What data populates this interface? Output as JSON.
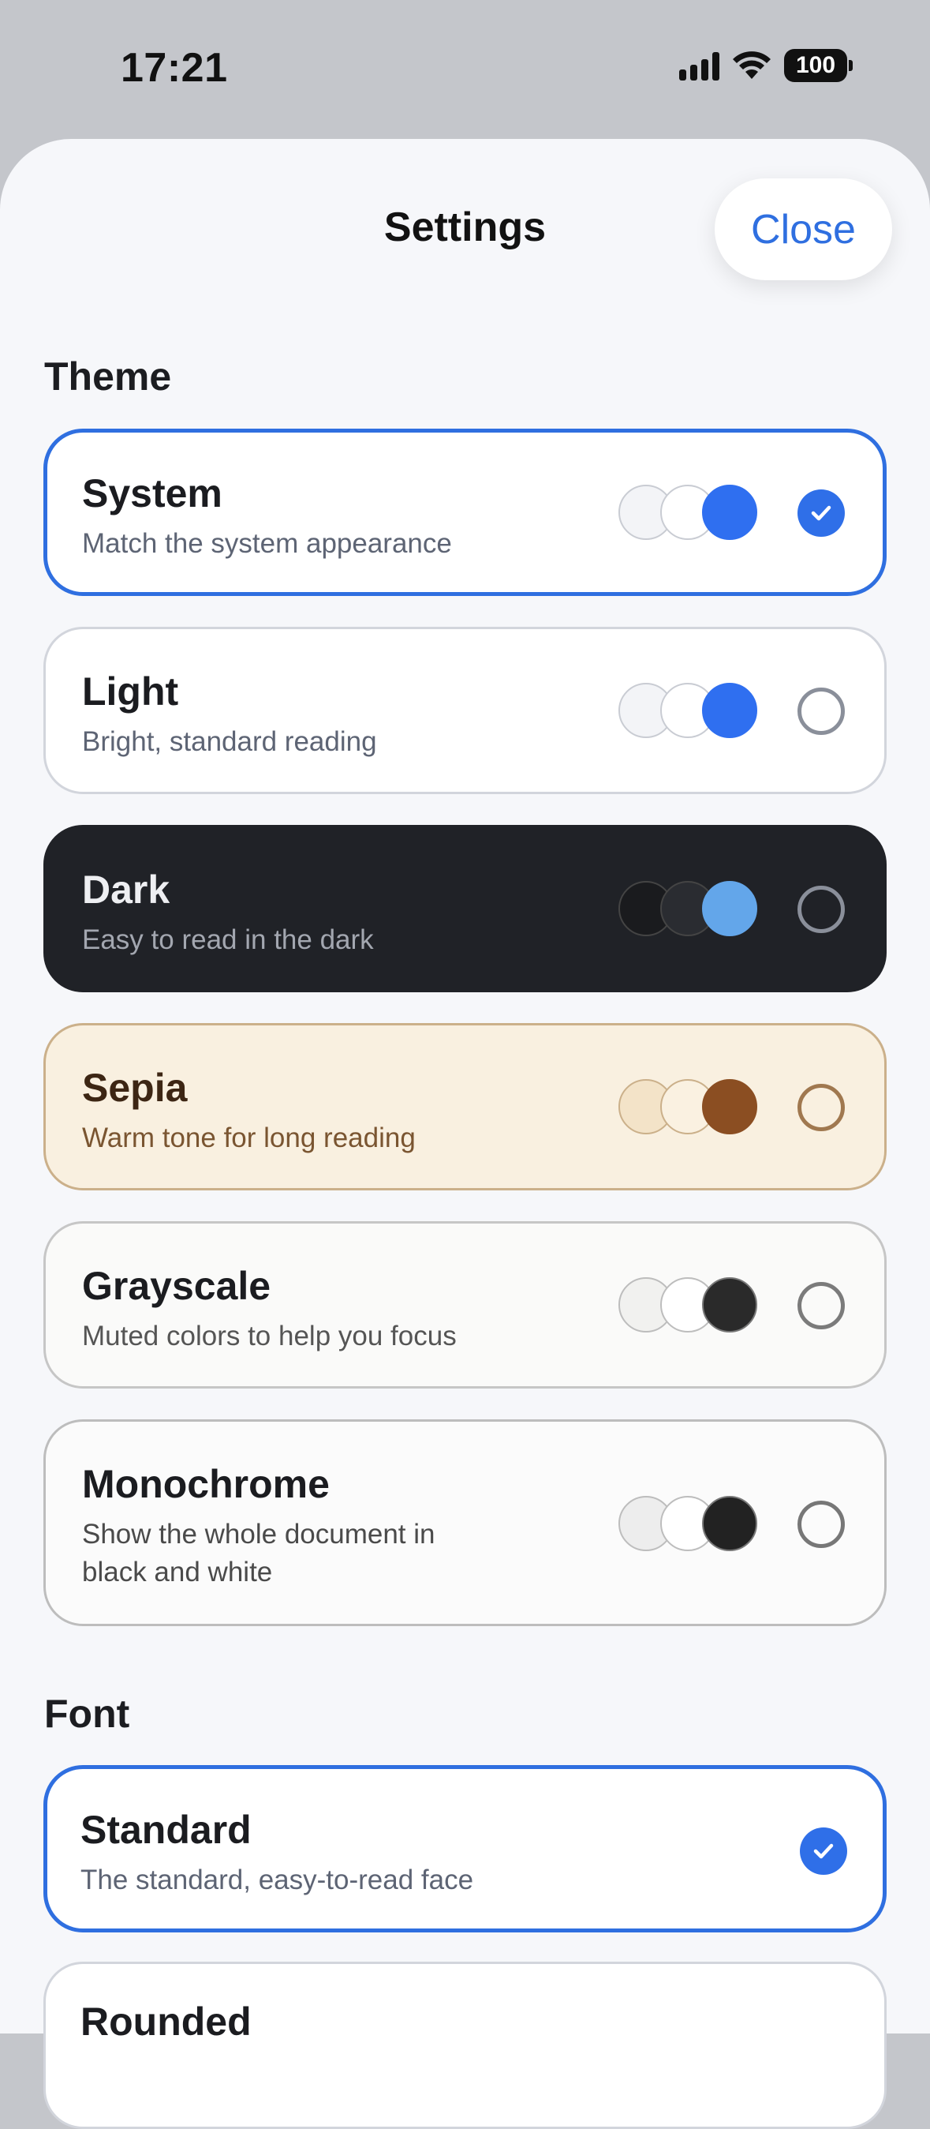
{
  "status_bar": {
    "time": "17:21",
    "battery": "100"
  },
  "sheet": {
    "title": "Settings",
    "close_label": "Close"
  },
  "theme_section": {
    "label": "Theme",
    "options": [
      {
        "title": "System",
        "subtitle": "Match the system appearance",
        "selected": true,
        "swatches": [
          "#f3f4f7",
          "#ffffff",
          "#2f6ff0"
        ]
      },
      {
        "title": "Light",
        "subtitle": "Bright, standard reading",
        "selected": false,
        "swatches": [
          "#f3f4f7",
          "#ffffff",
          "#2f6ff0"
        ]
      },
      {
        "title": "Dark",
        "subtitle": "Easy to read in the dark",
        "selected": false,
        "swatches": [
          "#1a1b1e",
          "#2a2c31",
          "#63a6ea"
        ]
      },
      {
        "title": "Sepia",
        "subtitle": "Warm tone for long reading",
        "selected": false,
        "swatches": [
          "#f3e3c8",
          "#faf1e1",
          "#8b4e22"
        ]
      },
      {
        "title": "Grayscale",
        "subtitle": "Muted colors to help you focus",
        "selected": false,
        "swatches": [
          "#f1f1ef",
          "#ffffff",
          "#2a2a2a"
        ]
      },
      {
        "title": "Monochrome",
        "subtitle": "Show the whole document in black and white",
        "selected": false,
        "swatches": [
          "#ededed",
          "#ffffff",
          "#222222"
        ]
      }
    ]
  },
  "font_section": {
    "label": "Font",
    "options": [
      {
        "title": "Standard",
        "subtitle": "The standard, easy-to-read face",
        "selected": true
      },
      {
        "title": "Rounded",
        "subtitle": "",
        "selected": false
      }
    ]
  },
  "colors": {
    "accent": "#2f6fe0"
  }
}
